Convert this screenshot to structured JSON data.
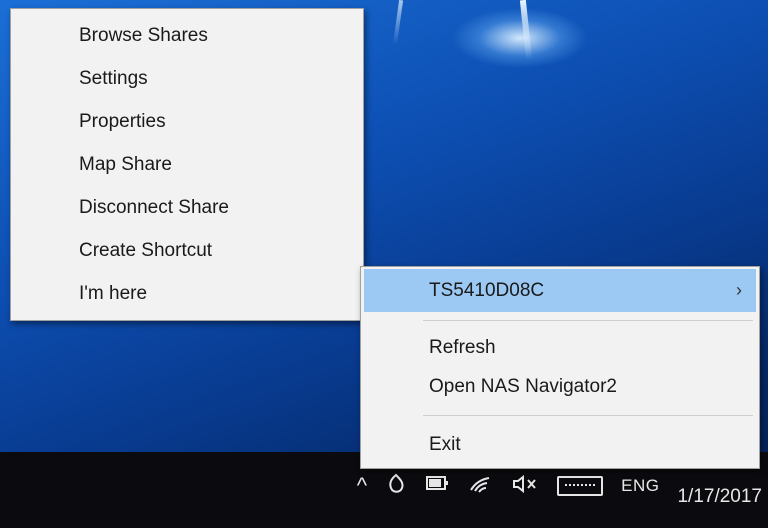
{
  "submenu": {
    "items": [
      {
        "label": "Browse Shares"
      },
      {
        "label": "Settings"
      },
      {
        "label": "Properties"
      },
      {
        "label": "Map Share"
      },
      {
        "label": "Disconnect Share"
      },
      {
        "label": "Create Shortcut"
      },
      {
        "label": "I'm here"
      }
    ]
  },
  "mainmenu": {
    "device": {
      "label": "TS5410D08C",
      "chevron": "›"
    },
    "refresh": {
      "label": "Refresh"
    },
    "open_nas": {
      "label": "Open NAS Navigator2"
    },
    "exit": {
      "label": "Exit"
    }
  },
  "tray": {
    "chevron_up": "^",
    "language": "ENG",
    "date": "1/17/2017",
    "icons": [
      "chevron-up-icon",
      "nas-navigator-icon",
      "battery-icon",
      "wifi-icon",
      "volume-muted-icon",
      "keyboard-icon"
    ]
  },
  "colors": {
    "highlight": "#9cc9f3",
    "menu_bg": "#f2f2f2",
    "taskbar": "#0b0b0f"
  }
}
